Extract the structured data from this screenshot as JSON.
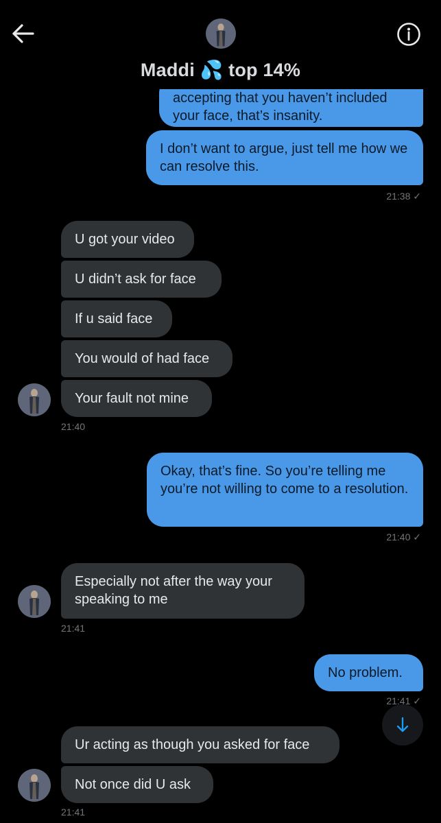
{
  "header": {
    "title": "Maddi 💦 top 14%",
    "back_icon": "arrow-left-icon",
    "info_icon": "info-circle-icon"
  },
  "messages": {
    "m1": {
      "text": "accepting that you haven’t included your face, that’s insanity."
    },
    "m2": {
      "text": "I don’t want to argue, just tell me how we can resolve this.",
      "time": "21:38 ✓"
    },
    "m3": {
      "text": "U got your video"
    },
    "m4": {
      "text": "U didn’t ask for face"
    },
    "m5": {
      "text": "If u said face"
    },
    "m6": {
      "text": "You would of had face"
    },
    "m7": {
      "text": "Your fault not mine",
      "time": "21:40"
    },
    "m8": {
      "text": "Okay, that’s fine. So you’re telling me you’re not willing to come to a resolution.",
      "time": "21:40 ✓"
    },
    "m9": {
      "text": "Especially not after the way your speaking to me",
      "time": "21:41"
    },
    "m10": {
      "text": "No problem.",
      "time": "21:41 ✓"
    },
    "m11": {
      "text": "Ur acting as though you asked for face"
    },
    "m12": {
      "text": "Not once did U ask",
      "time": "21:41"
    }
  },
  "colors": {
    "outgoing_bubble": "#4a99e9",
    "incoming_bubble": "#2f3336",
    "background": "#000000",
    "accent": "#1d9bf0"
  },
  "scroll_button": {
    "icon": "arrow-down-icon"
  }
}
